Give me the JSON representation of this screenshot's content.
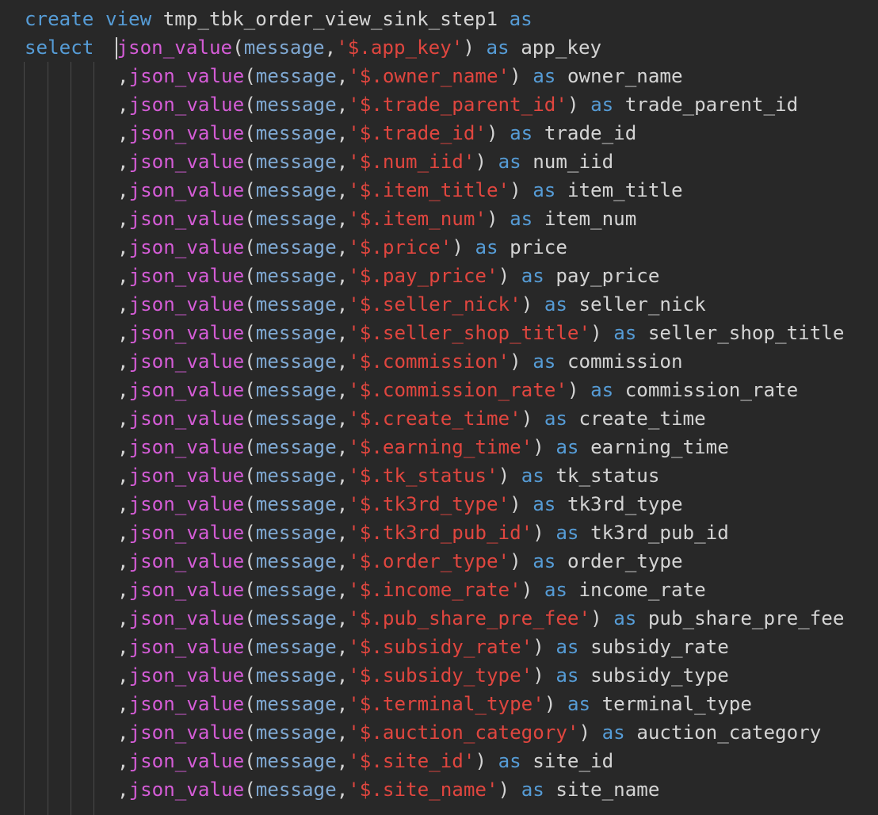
{
  "header": {
    "line1": {
      "kw_create": "create",
      "kw_view": "view",
      "view_name": "tmp_tbk_order_view_sink_step1",
      "kw_as": "as"
    },
    "line2": {
      "kw_select": "select",
      "fn": "json_value",
      "open": "(",
      "param": "message",
      "comma": ",",
      "path": "'$.app_key'",
      "close": ")",
      "kw_as": "as",
      "alias": "app_key"
    }
  },
  "code": {
    "fn": "json_value",
    "param": "message",
    "kw_as": "as",
    "lead_comma": ",",
    "open": "(",
    "sep": ",",
    "close": ")",
    "fields": [
      {
        "path": "'$.owner_name'",
        "alias": "owner_name"
      },
      {
        "path": "'$.trade_parent_id'",
        "alias": "trade_parent_id"
      },
      {
        "path": "'$.trade_id'",
        "alias": "trade_id"
      },
      {
        "path": "'$.num_iid'",
        "alias": "num_iid"
      },
      {
        "path": "'$.item_title'",
        "alias": "item_title"
      },
      {
        "path": "'$.item_num'",
        "alias": "item_num"
      },
      {
        "path": "'$.price'",
        "alias": "price"
      },
      {
        "path": "'$.pay_price'",
        "alias": "pay_price"
      },
      {
        "path": "'$.seller_nick'",
        "alias": "seller_nick"
      },
      {
        "path": "'$.seller_shop_title'",
        "alias": "seller_shop_title"
      },
      {
        "path": "'$.commission'",
        "alias": "commission"
      },
      {
        "path": "'$.commission_rate'",
        "alias": "commission_rate"
      },
      {
        "path": "'$.create_time'",
        "alias": "create_time"
      },
      {
        "path": "'$.earning_time'",
        "alias": "earning_time"
      },
      {
        "path": "'$.tk_status'",
        "alias": "tk_status"
      },
      {
        "path": "'$.tk3rd_type'",
        "alias": "tk3rd_type"
      },
      {
        "path": "'$.tk3rd_pub_id'",
        "alias": "tk3rd_pub_id"
      },
      {
        "path": "'$.order_type'",
        "alias": "order_type"
      },
      {
        "path": "'$.income_rate'",
        "alias": "income_rate"
      },
      {
        "path": "'$.pub_share_pre_fee'",
        "alias": "pub_share_pre_fee"
      },
      {
        "path": "'$.subsidy_rate'",
        "alias": "subsidy_rate"
      },
      {
        "path": "'$.subsidy_type'",
        "alias": "subsidy_type"
      },
      {
        "path": "'$.terminal_type'",
        "alias": "terminal_type"
      },
      {
        "path": "'$.auction_category'",
        "alias": "auction_category"
      },
      {
        "path": "'$.site_id'",
        "alias": "site_id"
      },
      {
        "path": "'$.site_name'",
        "alias": "site_name"
      }
    ]
  },
  "colors": {
    "background": "#282828",
    "keyword": "#569cd6",
    "function": "#d45cd6",
    "parameter": "#7fa8d2",
    "string": "#e0463f",
    "text": "#d4d4d4"
  }
}
